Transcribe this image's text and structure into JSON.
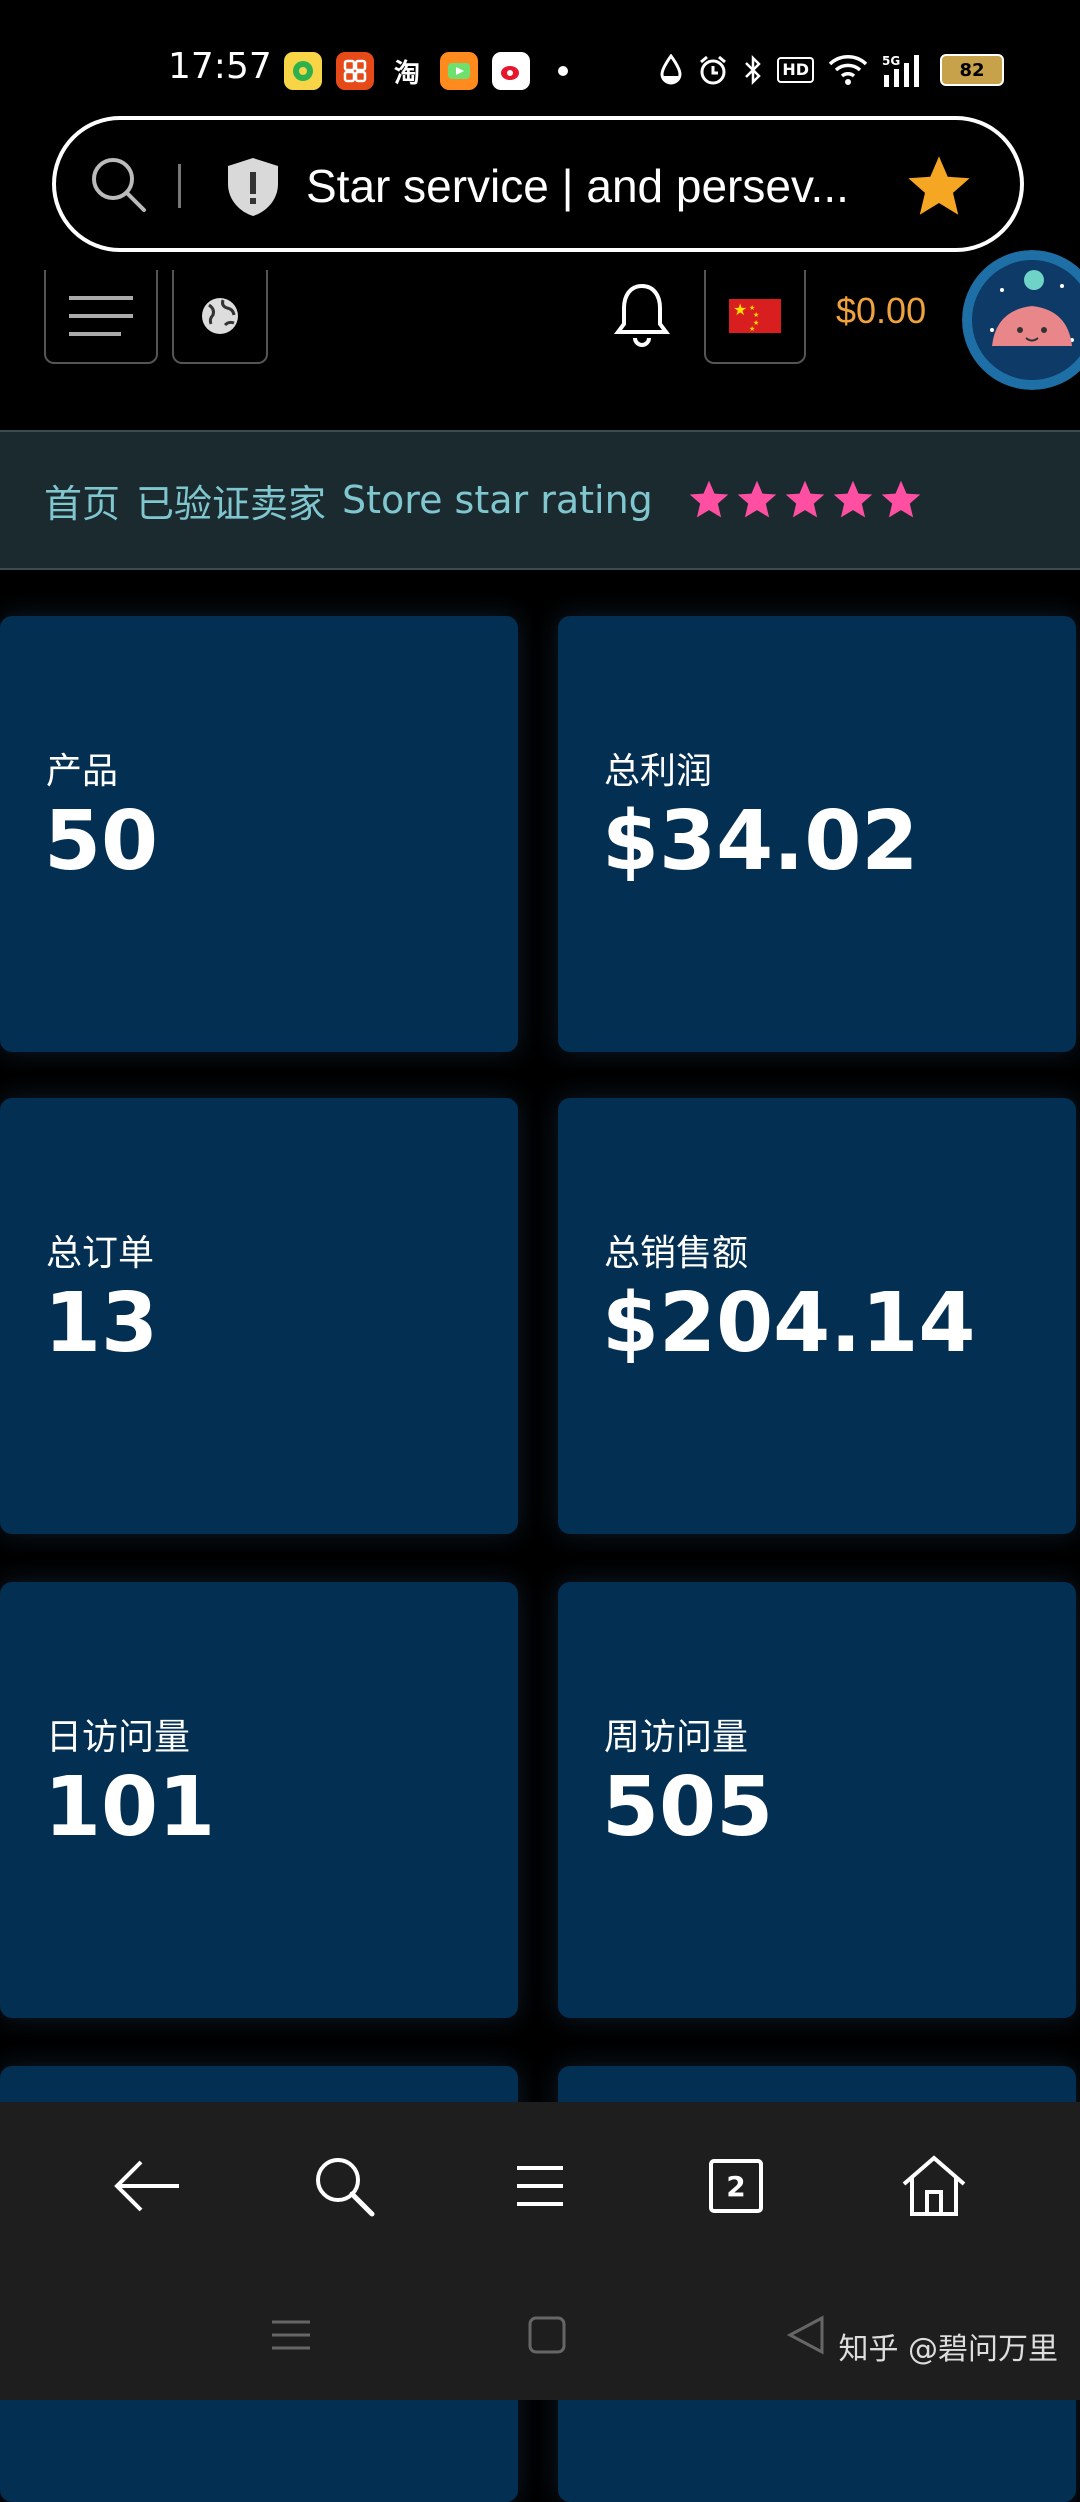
{
  "status_bar": {
    "time": "17:57",
    "app_icons": [
      "qq-music-icon",
      "pinduoduo-icon",
      "taobao-icon",
      "video-app-icon",
      "weibo-icon"
    ],
    "taobao_char": "淘",
    "network": "5G",
    "hd": "HD",
    "battery": "82"
  },
  "browser": {
    "url_title": "Star service | and persev...",
    "tab_count": "2"
  },
  "header": {
    "balance": "$0.00"
  },
  "breadcrumb": {
    "home": "首页",
    "verified_seller": "已验证卖家",
    "rating_label": "Store star rating",
    "rating": 5,
    "star_color": "#ff4fa3"
  },
  "cards": [
    {
      "label": "产品",
      "value": "50"
    },
    {
      "label": "总利润",
      "value": "$34.02"
    },
    {
      "label": "总订单",
      "value": "13"
    },
    {
      "label": "总销售额",
      "value": "$204.14"
    },
    {
      "label": "日访问量",
      "value": "101"
    },
    {
      "label": "周访问量",
      "value": "505"
    }
  ],
  "colors": {
    "card_bg": "#032f52",
    "breadcrumb_text": "#80c6cf",
    "balance": "#f0a33c",
    "bookmark_star": "#f5a623"
  },
  "watermark": "知乎 @碧问万里"
}
